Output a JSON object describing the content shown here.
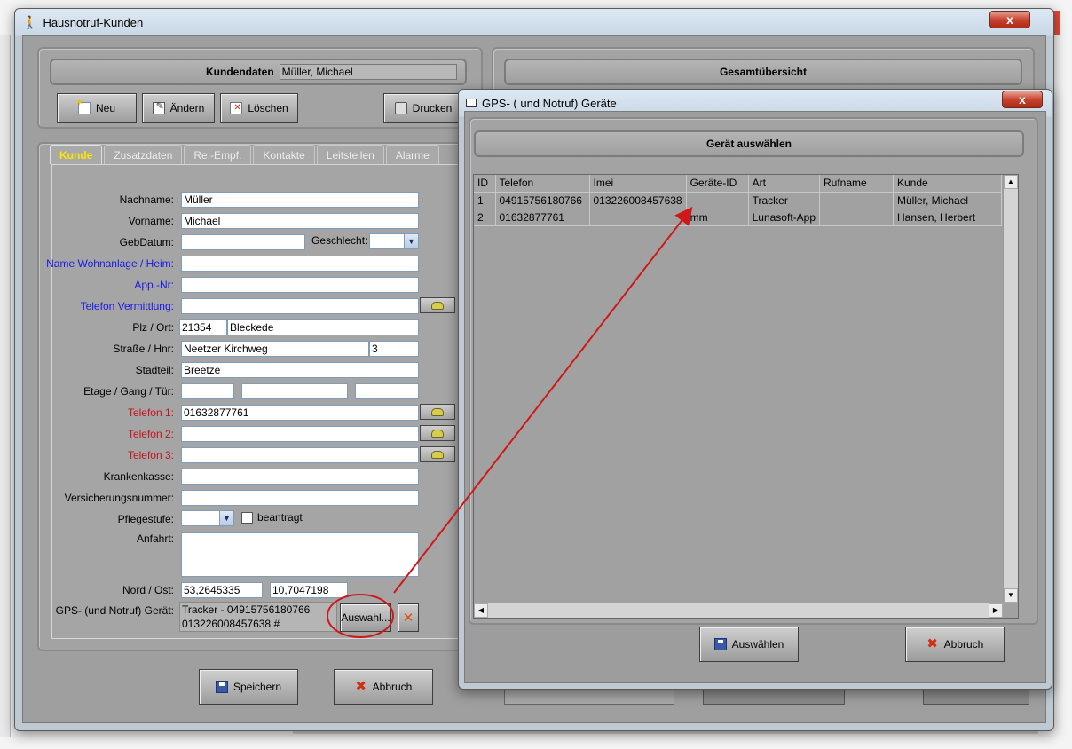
{
  "main_window": {
    "title": "Hausnotruf-Kunden",
    "close_label": "x",
    "kundendaten_label": "Kundendaten",
    "kundendaten_value": "Müller, Michael",
    "gesamt_label": "Gesamtübersicht",
    "buttons": {
      "neu": "Neu",
      "aendern": "Ändern",
      "loeschen": "Löschen",
      "drucken": "Drucken",
      "speichern": "Speichern",
      "abbruch": "Abbruch",
      "auswahl": "Auswahl...",
      "clear_gps": "✕"
    },
    "tabs": [
      "Kunde",
      "Zusatzdaten",
      "Re.-Empf.",
      "Kontakte",
      "Leitstellen",
      "Alarme"
    ],
    "form": {
      "nachname_label": "Nachname:",
      "nachname": "Müller",
      "vorname_label": "Vorname:",
      "vorname": "Michael",
      "gebdatum_label": "GebDatum:",
      "gebdatum": "",
      "geschlecht_label": "Geschlecht:",
      "geschlecht": "",
      "wohnanlage_label": "Name Wohnanlage / Heim:",
      "wohnanlage": "",
      "app_nr_label": "App.-Nr:",
      "app_nr": "",
      "tel_vermittlung_label": "Telefon Vermittlung:",
      "tel_vermittlung": "",
      "plz_ort_label": "Plz / Ort:",
      "plz": "21354",
      "ort": "Bleckede",
      "strasse_label": "Straße / Hnr:",
      "strasse": "Neetzer Kirchweg",
      "hnr": "3",
      "stadtteil_label": "Stadteil:",
      "stadtteil": "Breetze",
      "etage_label": "Etage / Gang / Tür:",
      "etage": "",
      "gang": "",
      "tuer": "",
      "telefon1_label": "Telefon 1:",
      "telefon1": "01632877761",
      "telefon2_label": "Telefon 2:",
      "telefon2": "",
      "telefon3_label": "Telefon 3:",
      "telefon3": "",
      "krankenkasse_label": "Krankenkasse:",
      "krankenkasse": "",
      "versicherung_label": "Versicherungsnummer:",
      "versicherung": "",
      "pflegestufe_label": "Pflegestufe:",
      "pflegestufe": "",
      "beantragt_label": "beantragt",
      "anfahrt_label": "Anfahrt:",
      "anfahrt": "",
      "nord_ost_label": "Nord / Ost:",
      "nord": "53,2645335",
      "ost": "10,7047198",
      "gps_label": "GPS- (und Notruf) Gerät:",
      "gps_line1": "Tracker - 04915756180766",
      "gps_line2": "013226008457638 #"
    }
  },
  "dialog": {
    "title": "GPS- ( und Notruf) Geräte",
    "close_label": "x",
    "header": "Gerät auswählen",
    "columns": [
      "ID",
      "Telefon",
      "Imei",
      "Geräte-ID",
      "Art",
      "Rufname",
      "Kunde"
    ],
    "rows": [
      [
        "1",
        "04915756180766",
        "013226008457638",
        "",
        "Tracker",
        "",
        "Müller, Michael"
      ],
      [
        "2",
        "01632877761",
        "",
        "mm",
        "Lunasoft-App",
        "",
        "Hansen, Herbert"
      ]
    ],
    "buttons": {
      "auswaehlen": "Auswählen",
      "abbruch": "Abbruch"
    }
  },
  "colors": {
    "annotation_red": "#d01818",
    "tab_active": "#ffe600",
    "label_blue": "#1a1ae6",
    "label_red": "#c4141c"
  }
}
